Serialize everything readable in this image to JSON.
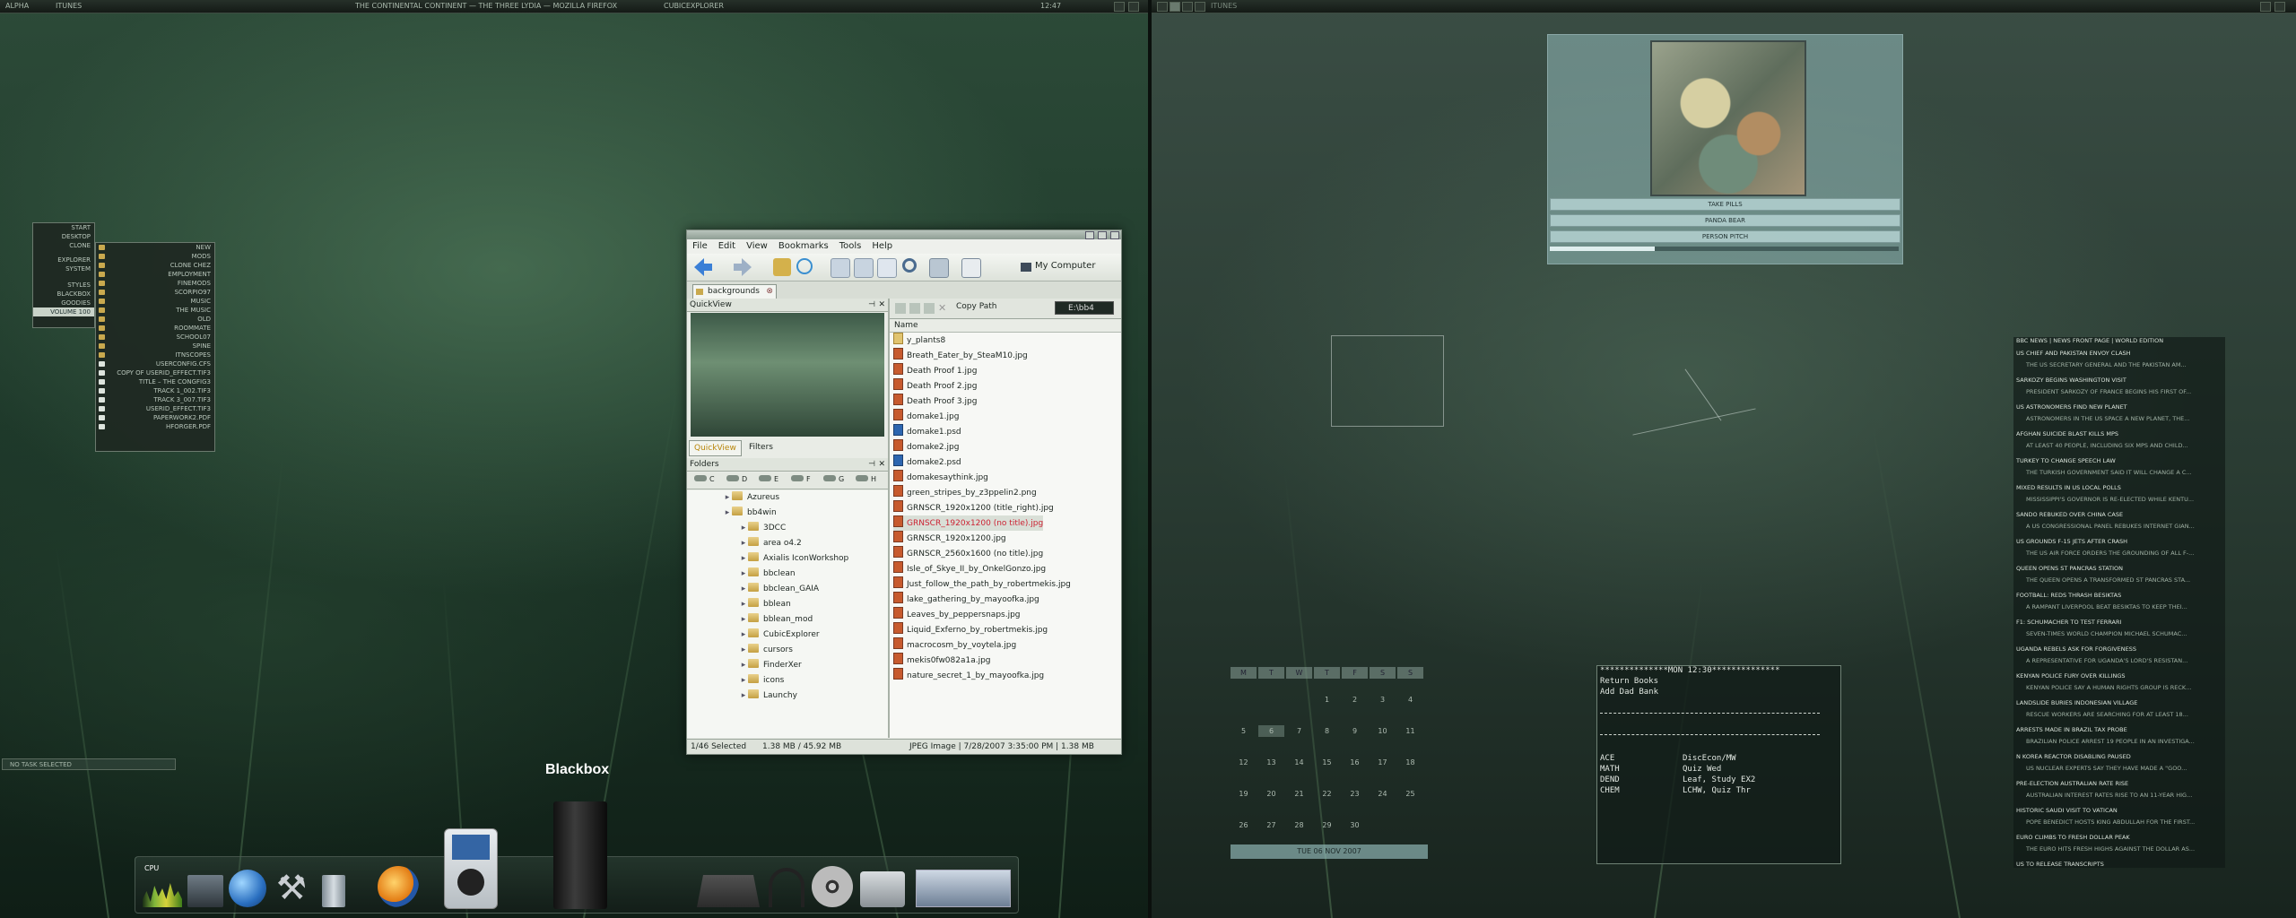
{
  "left_topbar": {
    "start": "ALPHA",
    "app": "ITUNES",
    "window1": "THE CONTINENTAL CONTINENT — THE THREE LYDIA — MOZILLA FIREFOX",
    "window2": "CUBICEXPLORER",
    "clock": "12:47"
  },
  "start_menu": [
    "START",
    "DESKTOP",
    "CLONE",
    "EXPLORER",
    "SYSTEM",
    "STYLES",
    "BLACKBOX",
    "GOODIES",
    "VOLUME 100"
  ],
  "sub_menu": [
    "NEW",
    "MODS",
    "CLONE CHEZ",
    "EMPLOYMENT",
    "FINEMODS",
    "SCORPIO97",
    "MUSIC",
    "THE MUSIC",
    "OLD",
    "ROOMMATE",
    "SCHOOL07",
    "SPINE",
    "ITNSCOPES",
    "USERCONFIG.CFS",
    "COPY OF USERID_EFFECT.TIF3",
    "TITLE – THE CONGFIG3",
    "TRACK 1_002.TIF3",
    "TRACK 3_007.TIF3",
    "USERID_EFFECT.TIF3",
    "PAPERWORK2.PDF",
    "HFORGER.PDF"
  ],
  "tray_label": "NO TASK SELECTED",
  "explorer": {
    "menu": [
      "File",
      "Edit",
      "View",
      "Bookmarks",
      "Tools",
      "Help"
    ],
    "location": "My Computer",
    "tab": "backgrounds",
    "quickview_title": "QuickView",
    "quickview_tab": "QuickView",
    "filters_tab": "Filters",
    "folders_title": "Folders",
    "drives": [
      "C",
      "D",
      "E",
      "F",
      "G",
      "H"
    ],
    "copy_path": "Copy Path",
    "path": "E:\\bb4",
    "col_name": "Name",
    "tree": [
      "Azureus",
      "bb4win",
      "3DCC",
      "area o4.2",
      "Axialis IconWorkshop",
      "bbclean",
      "bbclean_GAIA",
      "bblean",
      "bblean_mod",
      "CubicExplorer",
      "cursors",
      "FinderXer",
      "icons",
      "Launchy"
    ],
    "files": [
      "y_plants8",
      "Breath_Eater_by_SteaM10.jpg",
      "Death Proof 1.jpg",
      "Death Proof 2.jpg",
      "Death Proof 3.jpg",
      "domake1.jpg",
      "domake1.psd",
      "domake2.jpg",
      "domake2.psd",
      "domakesaythink.jpg",
      "green_stripes_by_z3ppelin2.png",
      "GRNSCR_1920x1200 (title_right).jpg",
      "GRNSCR_1920x1200 (no title).jpg",
      "GRNSCR_1920x1200.jpg",
      "GRNSCR_2560x1600 (no title).jpg",
      "Isle_of_Skye_II_by_OnkelGonzo.jpg",
      "Just_follow_the_path_by_robertmekis.jpg",
      "lake_gathering_by_mayoofka.jpg",
      "Leaves_by_peppersnaps.jpg",
      "Liquid_Exferno_by_robertmekis.jpg",
      "macrocosm_by_voytela.jpg",
      "mekis0fw082a1a.jpg",
      "nature_secret_1_by_mayoofka.jpg"
    ],
    "status_count": "1/46 Selected",
    "status_size": "1.38 MB / 45.92 MB",
    "status_info": "JPEG Image | 7/28/2007 3:35:00 PM | 1.38 MB"
  },
  "dock": {
    "cpu_label": "CPU",
    "blackbox_label": "Blackbox",
    "icons": [
      "cpu-meter-icon",
      "monitor-icon",
      "globe-icon",
      "tools-icon",
      "trash-icon",
      "media-player-icon",
      "ipod-icon",
      "blackbox-tower-icon",
      "typewriter-icon",
      "headphones-icon",
      "film-reel-icon",
      "camera-icon",
      "window-thumbnails-icon"
    ]
  },
  "album": {
    "tracks": [
      "TAKE PILLS",
      "PANDA BEAR",
      "PERSON PITCH"
    ],
    "progress": 0.3
  },
  "calendar": {
    "headers": [
      "M",
      "T",
      "W",
      "T",
      "F",
      "S",
      "S"
    ],
    "weeks": [
      [
        "",
        "",
        "",
        "1",
        "2",
        "3",
        "4"
      ],
      [
        "5",
        "6",
        "7",
        "8",
        "9",
        "10",
        "11"
      ],
      [
        "12",
        "13",
        "14",
        "15",
        "16",
        "17",
        "18"
      ],
      [
        "19",
        "20",
        "21",
        "22",
        "23",
        "24",
        "25"
      ],
      [
        "26",
        "27",
        "28",
        "29",
        "30",
        "",
        ""
      ]
    ],
    "footer": "TUE 06 NOV  2007"
  },
  "notes": {
    "header": "**************MON 12:30**************",
    "lines": [
      "Return Books",
      "Add Dad Bank"
    ],
    "classes": [
      [
        "ACE",
        "DiscEcon/MW"
      ],
      [
        "MATH",
        "Quiz Wed"
      ],
      [
        "DEND",
        "Leaf, Study EX2"
      ],
      [
        "CHEM",
        "LCHW, Quiz Thr"
      ]
    ]
  },
  "news": {
    "title": "BBC NEWS | NEWS FRONT PAGE | WORLD EDITION",
    "items": [
      [
        "US CHIEF AND PAKISTAN ENVOY CLASH",
        "THE US SECRETARY GENERAL AND THE PAKISTAN AM..."
      ],
      [
        "SARKOZY BEGINS WASHINGTON VISIT",
        "PRESIDENT SARKOZY OF FRANCE BEGINS HIS FIRST OF..."
      ],
      [
        "US ASTRONOMERS FIND NEW PLANET",
        "ASTRONOMERS IN THE US SPACE A NEW PLANET, THE..."
      ],
      [
        "AFGHAN SUICIDE BLAST KILLS MPS",
        "AT LEAST 40 PEOPLE, INCLUDING SIX MPS AND CHILD..."
      ],
      [
        "TURKEY TO CHANGE SPEECH LAW",
        "THE TURKISH GOVERNMENT SAID IT WILL CHANGE A C..."
      ],
      [
        "MIXED RESULTS IN US LOCAL POLLS",
        "MISSISSIPPI'S GOVERNOR IS RE-ELECTED WHILE KENTU..."
      ],
      [
        "SANDO REBUKED OVER CHINA CASE",
        "A US CONGRESSIONAL PANEL REBUKES INTERNET GIAN..."
      ],
      [
        "US GROUNDS F-15 JETS AFTER CRASH",
        "THE US AIR FORCE ORDERS THE GROUNDING OF ALL F-..."
      ],
      [
        "QUEEN OPENS ST PANCRAS STATION",
        "THE QUEEN OPENS A TRANSFORMED ST PANCRAS STA..."
      ],
      [
        "FOOTBALL: REDS THRASH BESIKTAS",
        "A RAMPANT LIVERPOOL BEAT BESIKTAS TO KEEP THEI..."
      ],
      [
        "F1: SCHUMACHER TO TEST FERRARI",
        "SEVEN-TIMES WORLD CHAMPION MICHAEL SCHUMAC..."
      ],
      [
        "UGANDA REBELS ASK FOR FORGIVENESS",
        "A REPRESENTATIVE FOR UGANDA'S LORD'S RESISTAN..."
      ],
      [
        "KENYAN POLICE FURY OVER KILLINGS",
        "KENYAN POLICE SAY A HUMAN RIGHTS GROUP IS RECK..."
      ],
      [
        "LANDSLIDE BURIES INDONESIAN VILLAGE",
        "RESCUE WORKERS ARE SEARCHING FOR AT LEAST 18..."
      ],
      [
        "ARRESTS MADE IN BRAZIL TAX PROBE",
        "BRAZILIAN POLICE ARREST 19 PEOPLE IN AN INVESTIGA..."
      ],
      [
        "N KOREA REACTOR DISABLING PAUSED",
        "US NUCLEAR EXPERTS SAY THEY HAVE MADE A \"GOO..."
      ],
      [
        "PRE-ELECTION AUSTRALIAN RATE RISE",
        "AUSTRALIAN INTEREST RATES RISE TO AN 11-YEAR HIG..."
      ],
      [
        "HISTORIC SAUDI VISIT TO VATICAN",
        "POPE BENEDICT HOSTS KING ABDULLAH FOR THE FIRST..."
      ],
      [
        "EURO CLIMBS TO FRESH DOLLAR PEAK",
        "THE EURO HITS FRESH HIGHS AGAINST THE DOLLAR AS..."
      ],
      [
        "US TO RELEASE TRANSCRIPTS",
        "..."
      ]
    ]
  },
  "right_topbar": {
    "label": "ITUNES"
  }
}
